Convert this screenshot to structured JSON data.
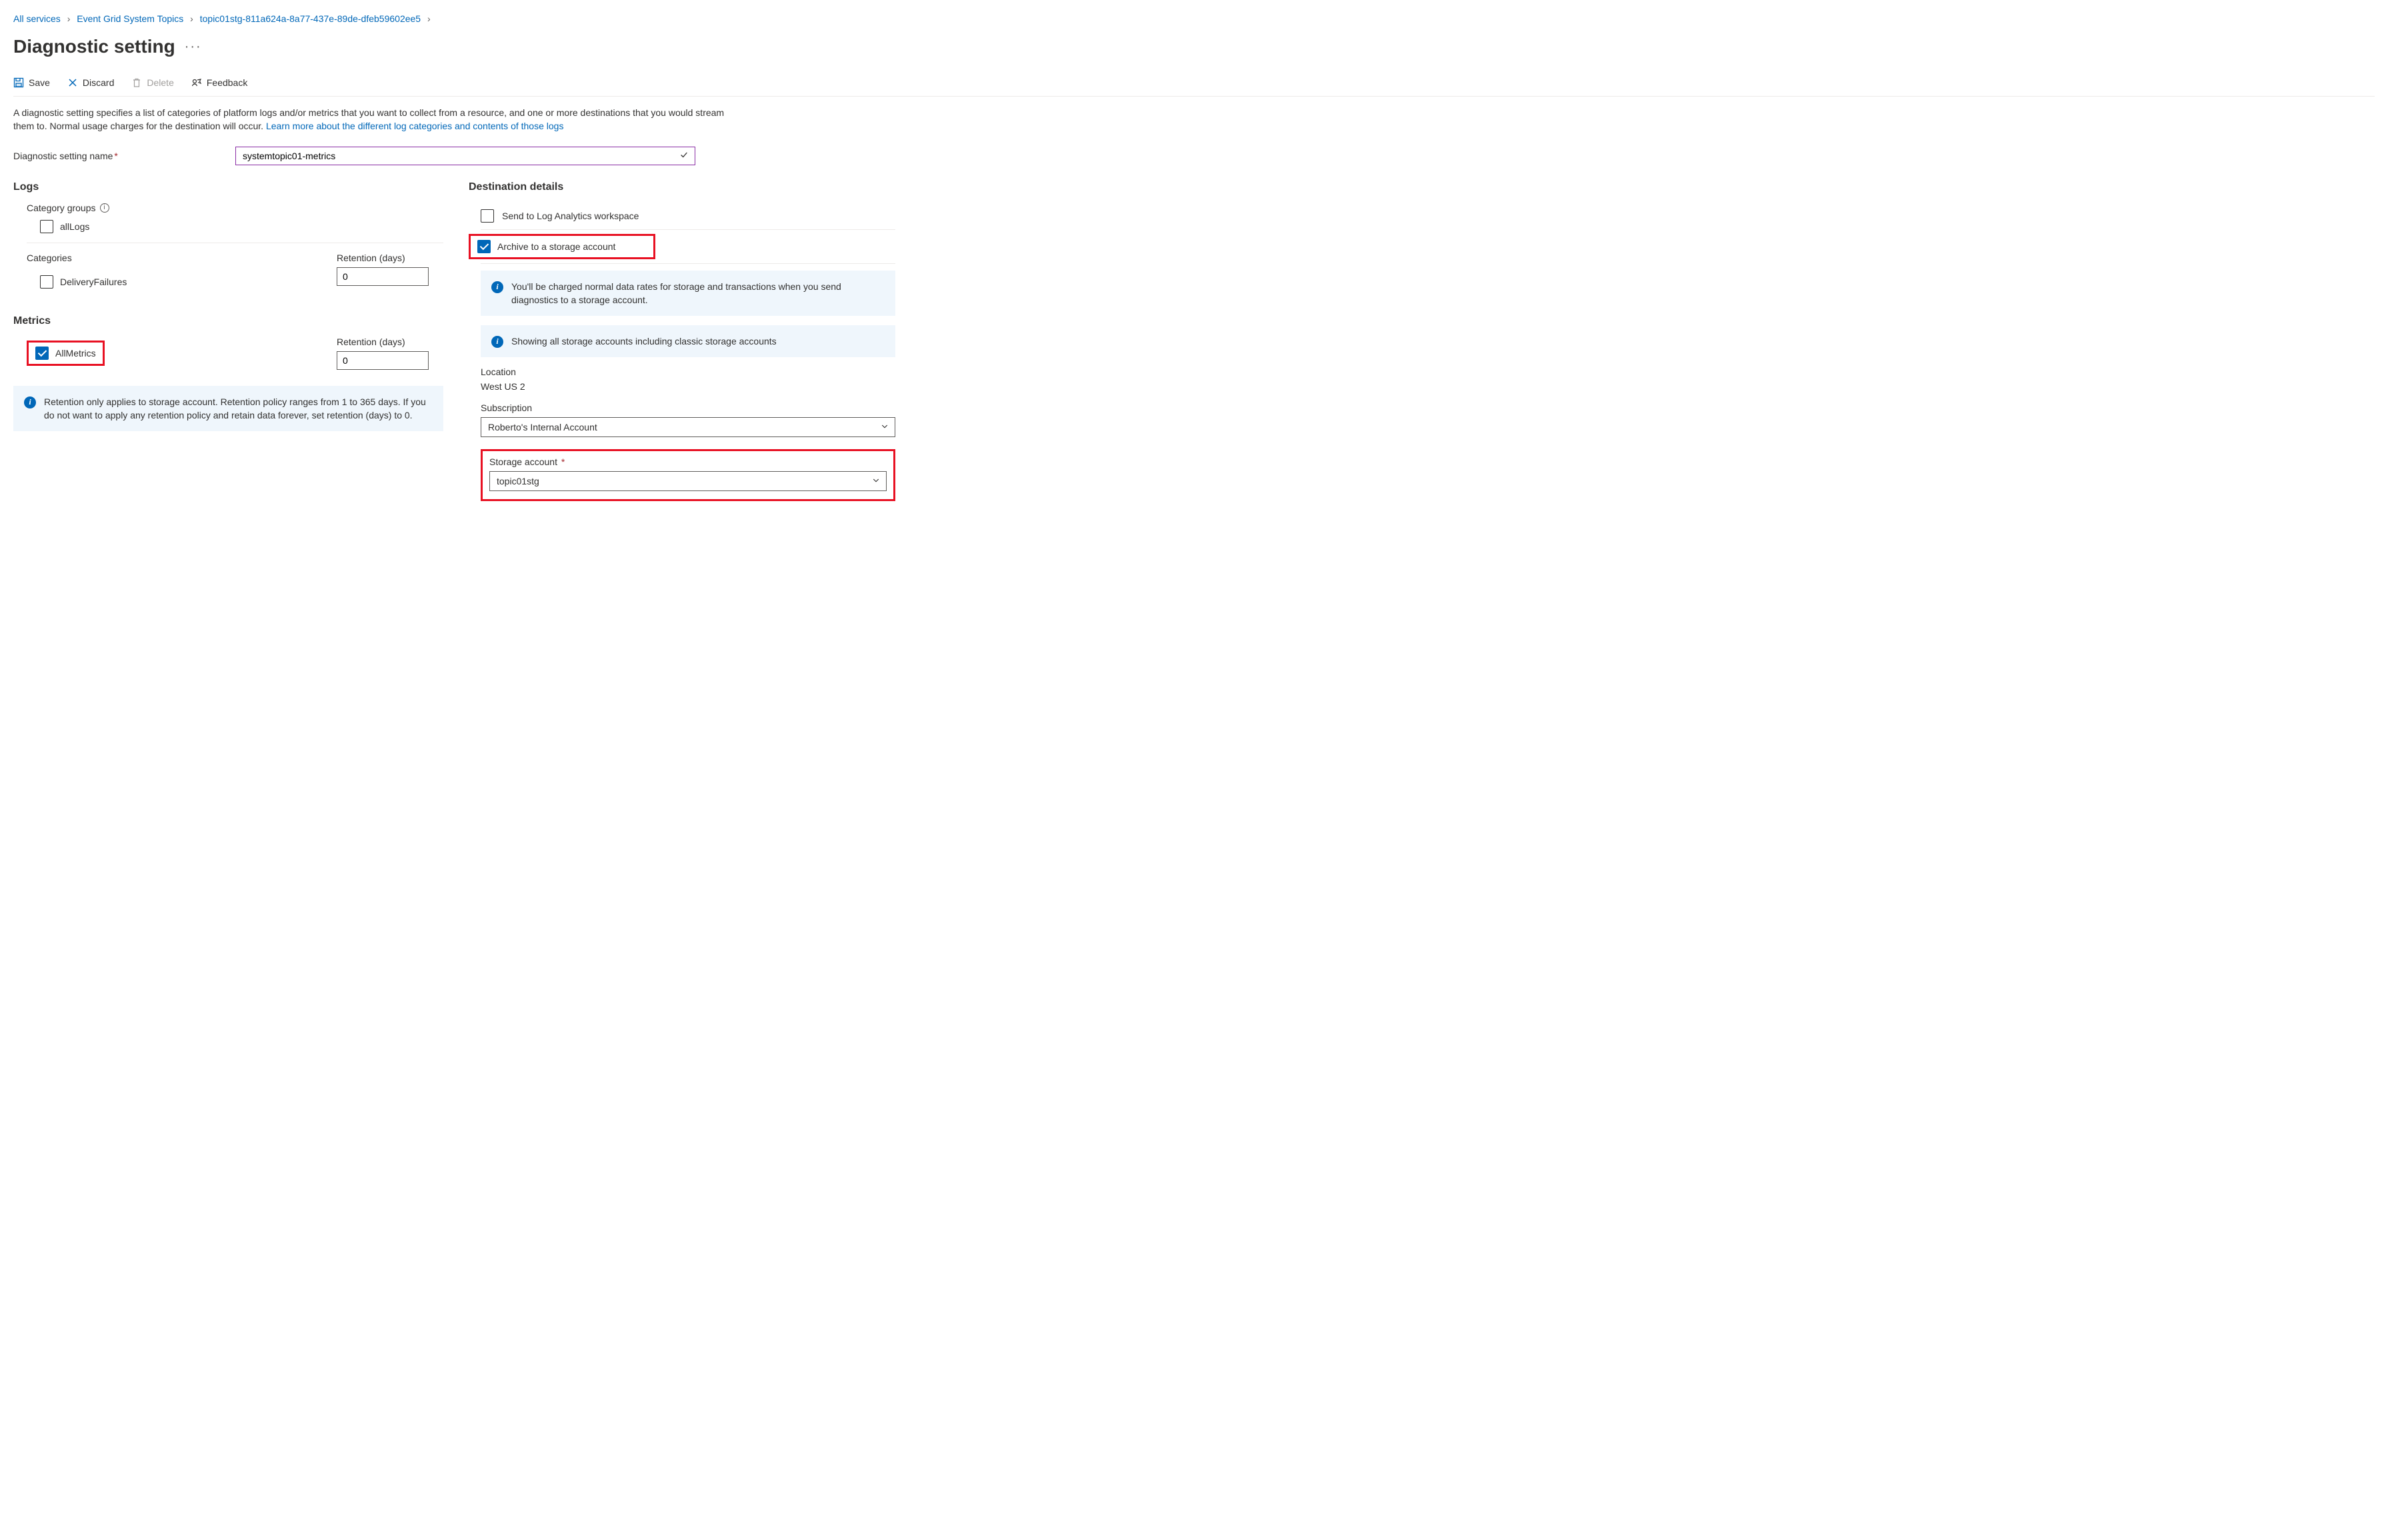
{
  "breadcrumb": {
    "items": [
      "All services",
      "Event Grid System Topics",
      "topic01stg-811a624a-8a77-437e-89de-dfeb59602ee5"
    ]
  },
  "page_title": "Diagnostic setting",
  "toolbar": {
    "save": "Save",
    "discard": "Discard",
    "delete": "Delete",
    "feedback": "Feedback"
  },
  "description": {
    "text": "A diagnostic setting specifies a list of categories of platform logs and/or metrics that you want to collect from a resource, and one or more destinations that you would stream them to. Normal usage charges for the destination will occur. ",
    "link": "Learn more about the different log categories and contents of those logs"
  },
  "name_field": {
    "label": "Diagnostic setting name",
    "value": "systemtopic01-metrics"
  },
  "logs": {
    "title": "Logs",
    "category_groups_label": "Category groups",
    "all_logs_label": "allLogs",
    "all_logs_checked": false,
    "categories_label": "Categories",
    "delivery_failures_label": "DeliveryFailures",
    "delivery_failures_checked": false,
    "retention_label": "Retention (days)",
    "retention_value": "0"
  },
  "metrics": {
    "title": "Metrics",
    "all_metrics_label": "AllMetrics",
    "all_metrics_checked": true,
    "retention_label": "Retention (days)",
    "retention_value": "0"
  },
  "retention_note": "Retention only applies to storage account. Retention policy ranges from 1 to 365 days. If you do not want to apply any retention policy and retain data forever, set retention (days) to 0.",
  "destination": {
    "title": "Destination details",
    "send_law_label": "Send to Log Analytics workspace",
    "send_law_checked": false,
    "archive_label": "Archive to a storage account",
    "archive_checked": true,
    "charge_note": "You'll be charged normal data rates for storage and transactions when you send diagnostics to a storage account.",
    "showing_note": "Showing all storage accounts including classic storage accounts",
    "location_label": "Location",
    "location_value": "West US 2",
    "subscription_label": "Subscription",
    "subscription_value": "Roberto's Internal Account",
    "storage_label": "Storage account",
    "storage_value": "topic01stg"
  }
}
